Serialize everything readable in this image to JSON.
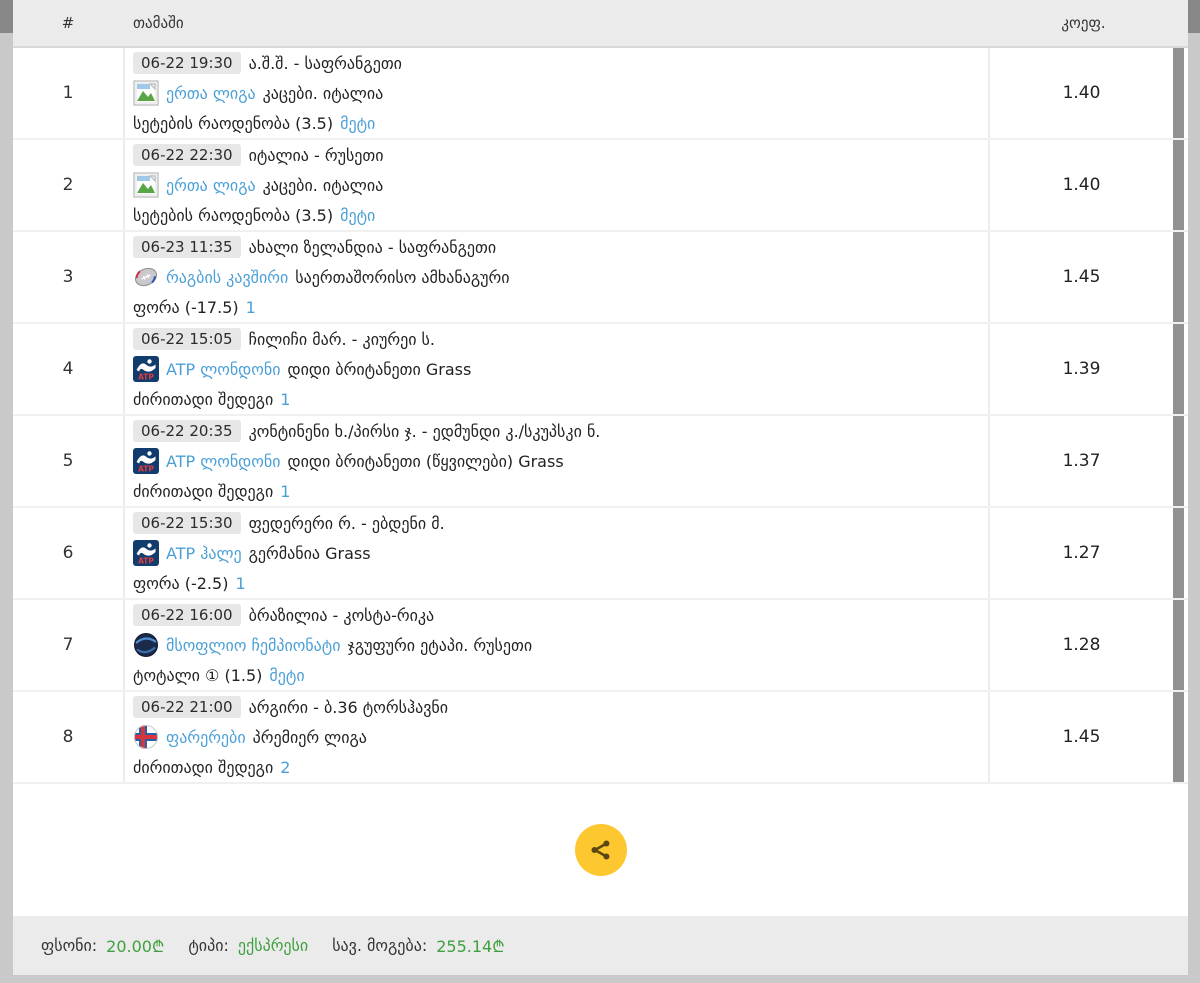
{
  "table": {
    "headers": {
      "num": "#",
      "game": "თამაში",
      "odds": "კოეფ."
    },
    "rows": [
      {
        "num": "1",
        "time": "06-22 19:30",
        "match": "ა.შ.შ. - საფრანგეთი",
        "icon": "img",
        "league": "ერთა ლიგა",
        "league_info": "კაცები. იტალია",
        "bet": "სეტების რაოდენობა (3.5)",
        "pick": "მეტი",
        "odds": "1.40"
      },
      {
        "num": "2",
        "time": "06-22 22:30",
        "match": "იტალია - რუსეთი",
        "icon": "img",
        "league": "ერთა ლიგა",
        "league_info": "კაცები. იტალია",
        "bet": "სეტების რაოდენობა (3.5)",
        "pick": "მეტი",
        "odds": "1.40"
      },
      {
        "num": "3",
        "time": "06-23 11:35",
        "match": "ახალი ზელანდია - საფრანგეთი",
        "icon": "rugby",
        "league": "რაგბის კავშირი",
        "league_info": "საერთაშორისო ამხანაგური",
        "bet": "ფორა (-17.5)",
        "pick": "1",
        "odds": "1.45"
      },
      {
        "num": "4",
        "time": "06-22 15:05",
        "match": "ჩილიჩი მარ. - კიურეი ს.",
        "icon": "atp",
        "league": "ATP ლონდონი",
        "league_info": "დიდი ბრიტანეთი Grass",
        "bet": "ძირითადი შედეგი",
        "pick": "1",
        "odds": "1.39"
      },
      {
        "num": "5",
        "time": "06-22 20:35",
        "match": "კონტინენი ხ./პირსი ჯ. - ედმუნდი კ./სკუპსკი ნ.",
        "icon": "atp",
        "league": "ATP ლონდონი",
        "league_info": "დიდი ბრიტანეთი (წყვილები) Grass",
        "bet": "ძირითადი შედეგი",
        "pick": "1",
        "odds": "1.37"
      },
      {
        "num": "6",
        "time": "06-22 15:30",
        "match": "ფედერერი რ. - ებდენი მ.",
        "icon": "atp",
        "league": "ATP ჰალე",
        "league_info": "გერმანია Grass",
        "bet": "ფორა (-2.5)",
        "pick": "1",
        "odds": "1.27"
      },
      {
        "num": "7",
        "time": "06-22 16:00",
        "match": "ბრაზილია - კოსტა-რიკა",
        "icon": "globe",
        "league": "მსოფლიო ჩემპიონატი",
        "league_info": "ჯგუფური ეტაპი. რუსეთი",
        "bet": "ტოტალი ① (1.5)",
        "pick": "მეტი",
        "odds": "1.28"
      },
      {
        "num": "8",
        "time": "06-22 21:00",
        "match": "არგირი - ბ.36 ტორსჰავნი",
        "icon": "faroe",
        "league": "ფარერები",
        "league_info": "პრემიერ ლიგა",
        "bet": "ძირითადი შედეგი",
        "pick": "2",
        "odds": "1.45"
      }
    ]
  },
  "footer": {
    "stake_label": "ფსონი:",
    "stake_value": "20.00₾",
    "type_label": "ტიპი:",
    "type_value": "ექსპრესი",
    "win_label": "სავ. მოგება:",
    "win_value": "255.14₾"
  },
  "colors": {
    "link_blue": "#4a9fd6",
    "value_green": "#3fa03f",
    "share_yellow": "#fcc72f",
    "header_bg": "#ebebeb",
    "footer_bg": "#ebebeb",
    "page_bg": "#c9c9c9",
    "top_band": "#878787",
    "row_strip": "#919191"
  }
}
